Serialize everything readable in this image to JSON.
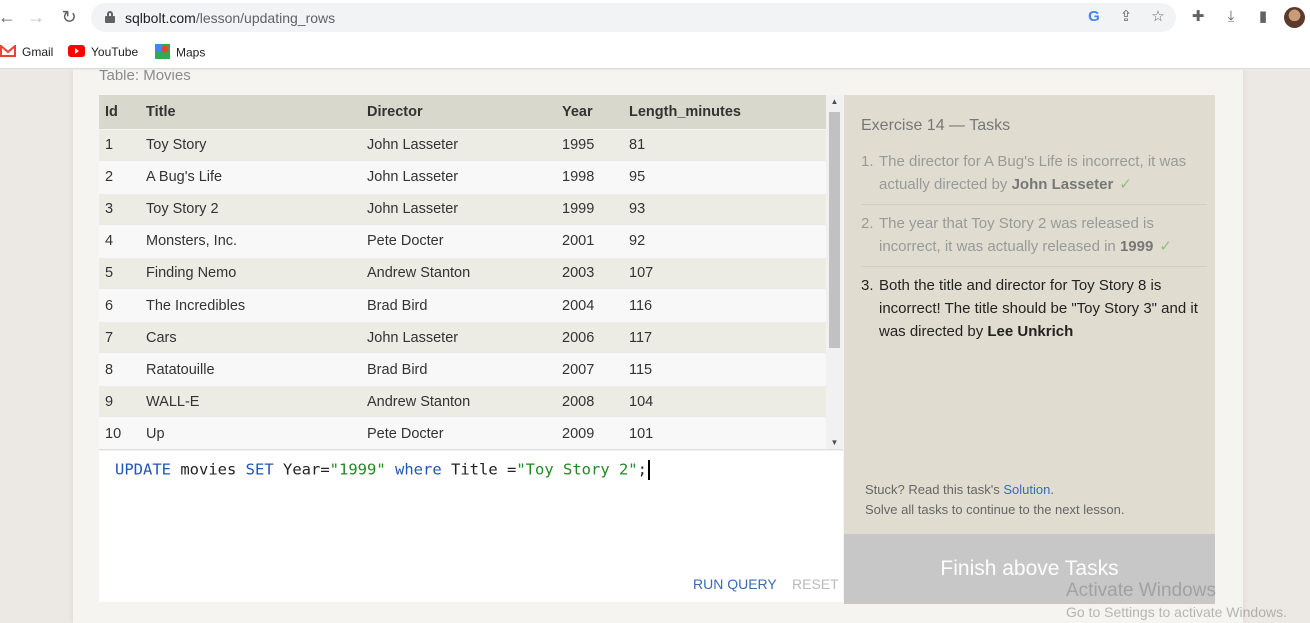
{
  "browser": {
    "url_host": "sqlbolt.com",
    "url_path": "/lesson/updating_rows",
    "bookmarks": [
      {
        "label": "Gmail",
        "icon": "gmail-icon"
      },
      {
        "label": "YouTube",
        "icon": "youtube-icon"
      },
      {
        "label": "Maps",
        "icon": "maps-icon"
      }
    ]
  },
  "table": {
    "caption": "Table: Movies",
    "headers": [
      "Id",
      "Title",
      "Director",
      "Year",
      "Length_minutes"
    ],
    "rows": [
      [
        "1",
        "Toy Story",
        "John Lasseter",
        "1995",
        "81"
      ],
      [
        "2",
        "A Bug's Life",
        "John Lasseter",
        "1998",
        "95"
      ],
      [
        "3",
        "Toy Story 2",
        "John Lasseter",
        "1999",
        "93"
      ],
      [
        "4",
        "Monsters, Inc.",
        "Pete Docter",
        "2001",
        "92"
      ],
      [
        "5",
        "Finding Nemo",
        "Andrew Stanton",
        "2003",
        "107"
      ],
      [
        "6",
        "The Incredibles",
        "Brad Bird",
        "2004",
        "116"
      ],
      [
        "7",
        "Cars",
        "John Lasseter",
        "2006",
        "117"
      ],
      [
        "8",
        "Ratatouille",
        "Brad Bird",
        "2007",
        "115"
      ],
      [
        "9",
        "WALL-E",
        "Andrew Stanton",
        "2008",
        "104"
      ],
      [
        "10",
        "Up",
        "Pete Docter",
        "2009",
        "101"
      ]
    ]
  },
  "editor": {
    "query": {
      "kw_update": "UPDATE",
      "t_movies": " movies ",
      "kw_set": "SET",
      "t_year": " Year=",
      "s_1999": "\"1999\"",
      "kw_where": "where",
      "t_title": " Title =",
      "s_title": "\"Toy Story 2\"",
      "t_semi": ";"
    },
    "run_label": "RUN QUERY",
    "reset_label": "RESET"
  },
  "tasks": {
    "title": "Exercise 14 — Tasks",
    "items": [
      {
        "num": "1.",
        "text": "The director for A Bug's Life is incorrect, it was actually directed by ",
        "bold": "John Lasseter",
        "tail": "",
        "check": "✓"
      },
      {
        "num": "2.",
        "text": "The year that Toy Story 2 was released is incorrect, it was actually released in ",
        "bold": "1999",
        "tail": "",
        "check": "✓"
      },
      {
        "num": "3.",
        "text": "Both the title and director for Toy Story 8 is incorrect! The title should be \"Toy Story 3\" and it was directed by ",
        "bold": "Lee Unkrich",
        "tail": "",
        "check": ""
      }
    ],
    "stuck_prefix": "Stuck? Read this task's ",
    "solution_link": "Solution",
    "stuck_suffix": ".",
    "continue_text": "Solve all tasks to continue to the next lesson.",
    "finish_label": "Finish above Tasks"
  },
  "watermark": {
    "line1": "Activate Windows",
    "line2": "Go to Settings to activate Windows."
  },
  "colors": {
    "keyword": "#2255bb",
    "string": "#228822",
    "link": "#3a6ab5",
    "check": "#8fbf7a"
  }
}
